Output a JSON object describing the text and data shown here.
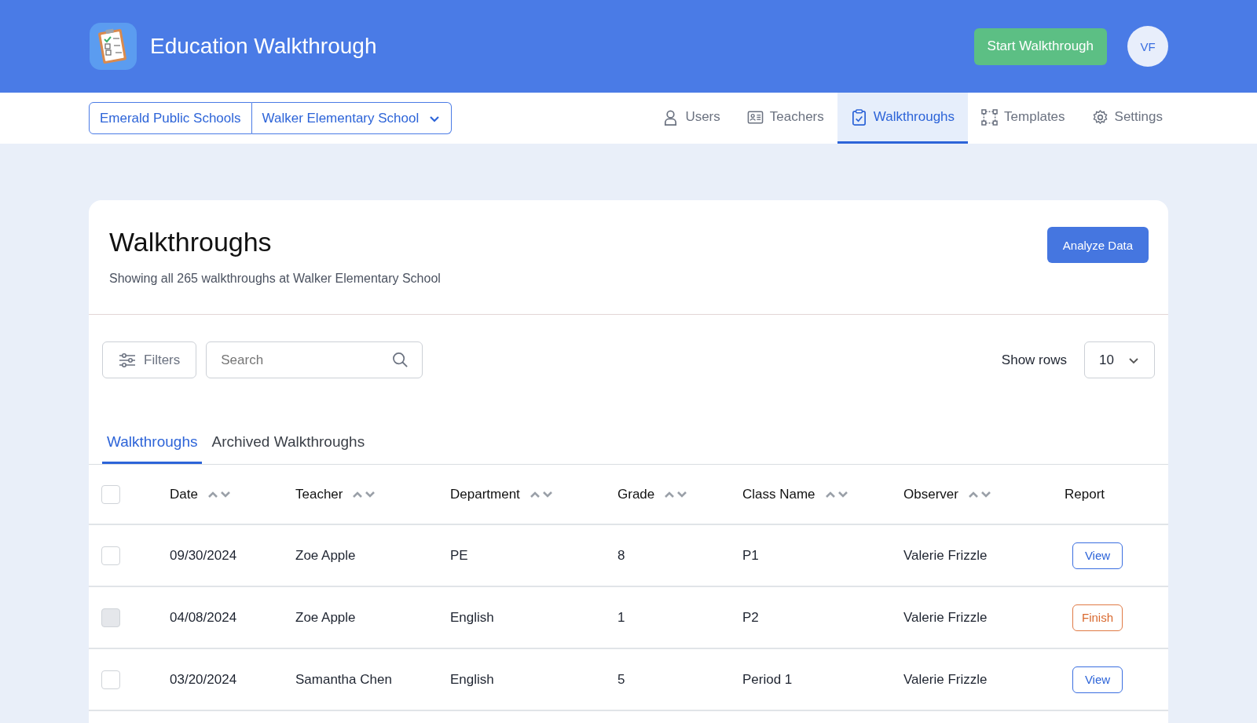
{
  "app": {
    "title": "Education Walkthrough",
    "start_button": "Start Walkthrough",
    "avatar": "VF"
  },
  "org_selector": {
    "district": "Emerald Public Schools",
    "school": "Walker Elementary School"
  },
  "nav": [
    {
      "label": "Users",
      "selected": false
    },
    {
      "label": "Teachers",
      "selected": false
    },
    {
      "label": "Walkthroughs",
      "selected": true
    },
    {
      "label": "Templates",
      "selected": false
    },
    {
      "label": "Settings",
      "selected": false
    }
  ],
  "page": {
    "title": "Walkthroughs",
    "subtitle": "Showing all 265 walkthroughs at Walker Elementary School",
    "action": "Analyze Data"
  },
  "toolbar": {
    "filters": "Filters",
    "search": {
      "placeholder": "Search"
    },
    "show_rows_label": "Show rows",
    "rows_value": "10"
  },
  "tabs": [
    {
      "label": "Walkthroughs",
      "selected": true
    },
    {
      "label": "Archived Walkthroughs",
      "selected": false
    }
  ],
  "table": {
    "select_all_checked": false,
    "columns": [
      {
        "label": "Date",
        "sortable": true
      },
      {
        "label": "Teacher",
        "sortable": true
      },
      {
        "label": "Department",
        "sortable": true
      },
      {
        "label": "Grade",
        "sortable": true
      },
      {
        "label": "Class Name",
        "sortable": true
      },
      {
        "label": "Observer",
        "sortable": true
      },
      {
        "label": "Report",
        "sortable": false
      }
    ],
    "rows": [
      {
        "disabled": false,
        "checked": false,
        "cells": [
          "09/30/2024",
          "Zoe Apple",
          "PE",
          "8",
          "P1",
          "Valerie Frizzle"
        ],
        "report": {
          "kind": "view",
          "label": "View"
        }
      },
      {
        "disabled": true,
        "checked": false,
        "cells": [
          "04/08/2024",
          "Zoe Apple",
          "English",
          "1",
          "P2",
          "Valerie Frizzle"
        ],
        "report": {
          "kind": "finish",
          "label": "Finish"
        }
      },
      {
        "disabled": false,
        "checked": false,
        "cells": [
          "03/20/2024",
          "Samantha Chen",
          "English",
          "5",
          "Period 1",
          "Valerie Frizzle"
        ],
        "report": {
          "kind": "view",
          "label": "View"
        }
      }
    ]
  }
}
